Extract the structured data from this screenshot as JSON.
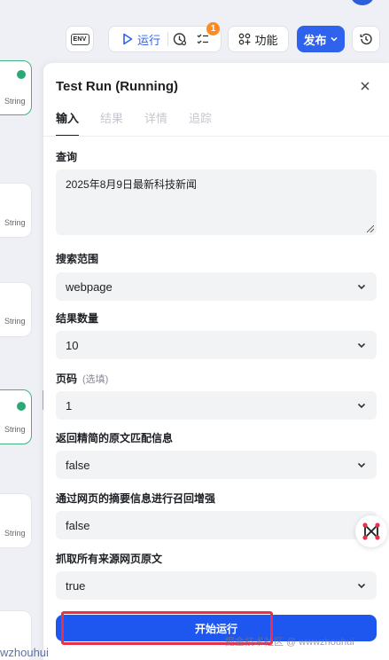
{
  "toolbar": {
    "env_label": "ENV",
    "run_label": "运行",
    "notification_count": "1",
    "feature_label": "功能",
    "publish_label": "发布"
  },
  "canvas": {
    "node_output_type": "String"
  },
  "panel": {
    "title": "Test Run (Running)",
    "tabs": [
      "输入",
      "结果",
      "详情",
      "追踪"
    ],
    "fields": {
      "query": {
        "label": "查询",
        "value": "2025年8月9日最新科技新闻"
      },
      "search_scope": {
        "label": "搜索范围",
        "value": "webpage"
      },
      "result_count": {
        "label": "结果数量",
        "value": "10"
      },
      "page": {
        "label": "页码",
        "hint": "(选填)",
        "value": "1"
      },
      "concise_match": {
        "label": "返回精简的原文匹配信息",
        "value": "false"
      },
      "summary_recall": {
        "label": "通过网页的摘要信息进行召回增强",
        "value": "false"
      },
      "fetch_full_text": {
        "label": "抓取所有来源网页原文",
        "value": "true"
      }
    },
    "run_button_label": "开始运行"
  },
  "watermark": {
    "right": "掘金技术社区 @ wwwzhouhui",
    "left": "wzhouhui"
  },
  "colors": {
    "primary": "#1e56f0",
    "highlight": "#e8304a",
    "badge": "#ff8a1f",
    "success": "#2aa876"
  }
}
